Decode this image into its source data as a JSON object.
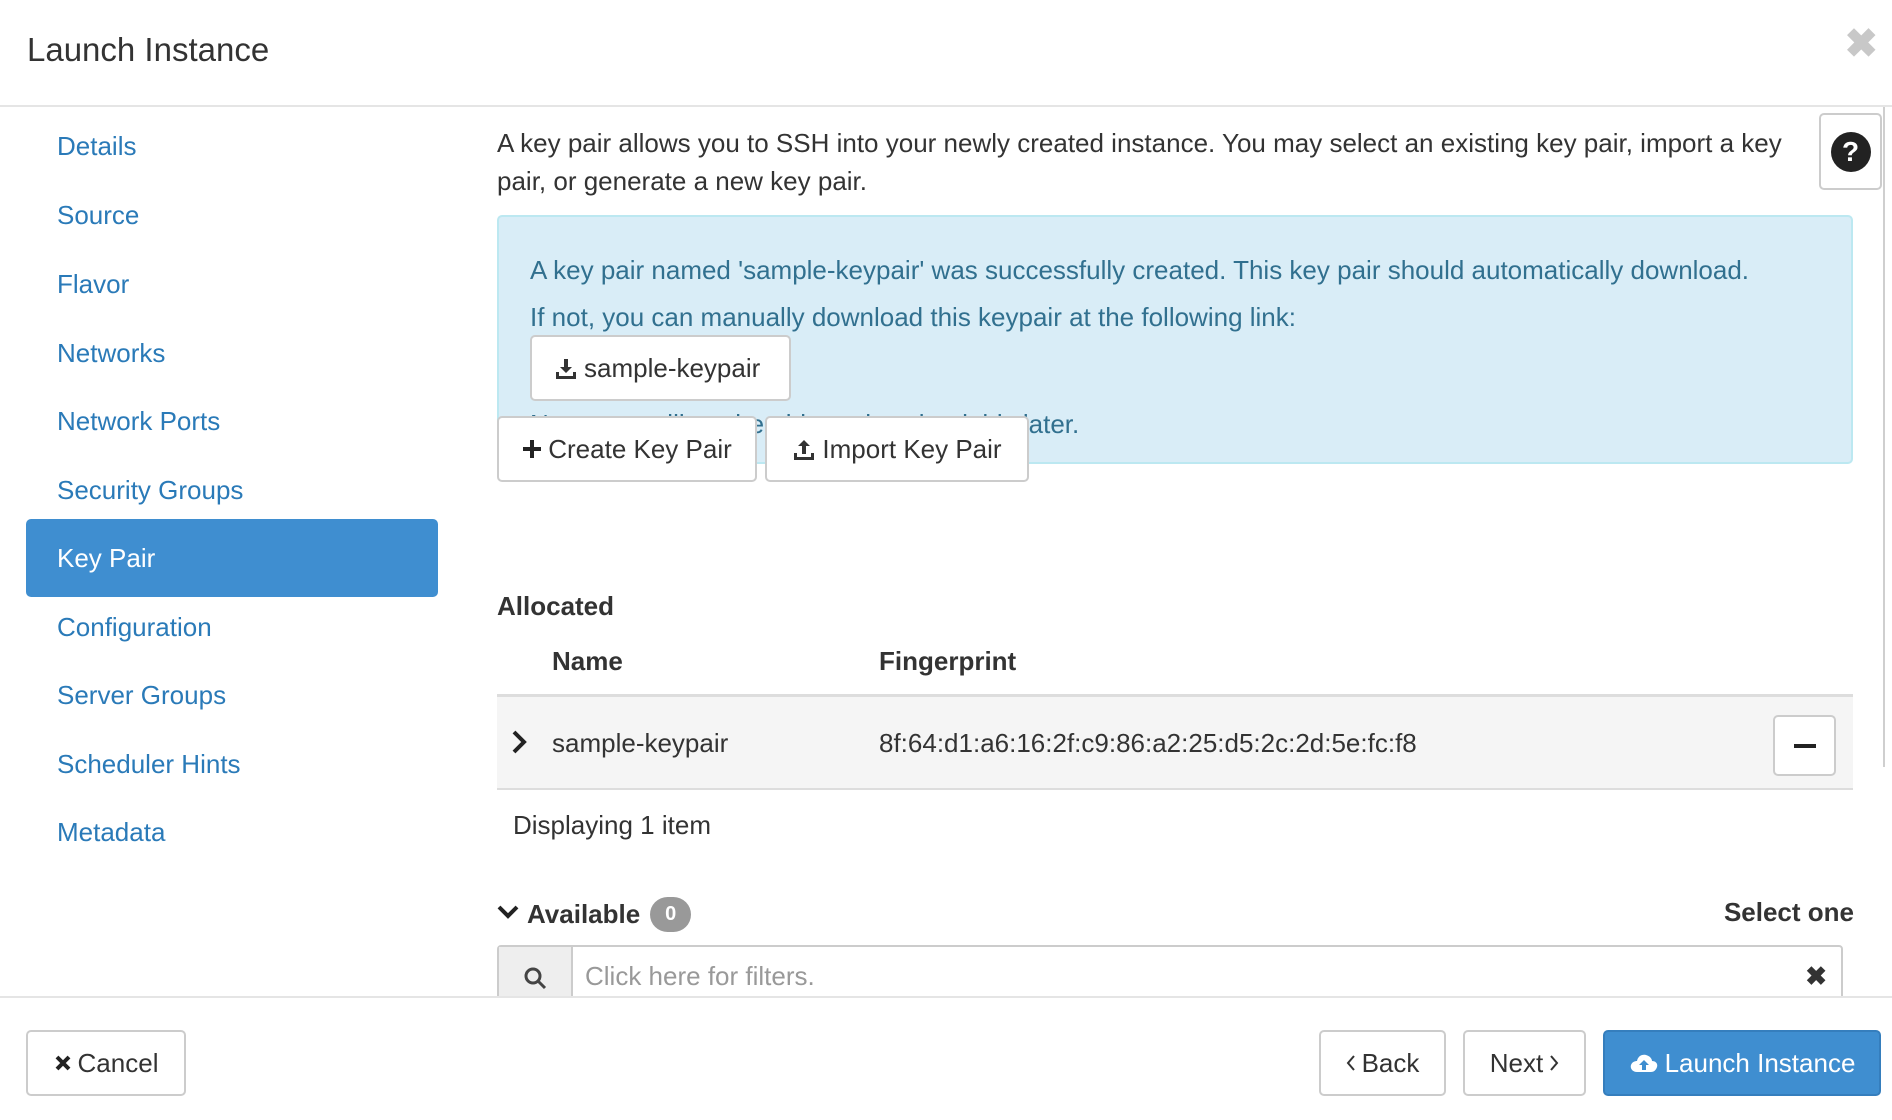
{
  "modal": {
    "title": "Launch Instance",
    "close_glyph": "✖"
  },
  "sidebar": {
    "items": [
      {
        "label": "Details",
        "active": false
      },
      {
        "label": "Source",
        "active": false
      },
      {
        "label": "Flavor",
        "active": false
      },
      {
        "label": "Networks",
        "active": false
      },
      {
        "label": "Network Ports",
        "active": false
      },
      {
        "label": "Security Groups",
        "active": false
      },
      {
        "label": "Key Pair",
        "active": true
      },
      {
        "label": "Configuration",
        "active": false
      },
      {
        "label": "Server Groups",
        "active": false
      },
      {
        "label": "Scheduler Hints",
        "active": false
      },
      {
        "label": "Metadata",
        "active": false
      }
    ]
  },
  "main": {
    "intro": "A key pair allows you to SSH into your newly created instance. You may select an existing key pair, import a key pair, or generate a new key pair.",
    "help_glyph": "?",
    "alert": {
      "line1": "A key pair named 'sample-keypair' was successfully created. This key pair should automatically download.",
      "line2": "If not, you can manually download this keypair at the following link:",
      "download_label": "sample-keypair",
      "note": "Note: you will not be able to download this later."
    },
    "create_key_pair_label": "Create Key Pair",
    "import_key_pair_label": "Import Key Pair",
    "allocated": {
      "heading": "Allocated",
      "columns": [
        "Name",
        "Fingerprint"
      ],
      "rows": [
        {
          "name": "sample-keypair",
          "fingerprint": "8f:64:d1:a6:16:2f:c9:86:a2:25:d5:2c:2d:5e:fc:f8"
        }
      ],
      "displaying": "Displaying 1 item"
    },
    "available": {
      "heading": "Available",
      "count": "0",
      "select_hint": "Select one",
      "filter_placeholder": "Click here for filters.",
      "filter_clear_glyph": "✖"
    }
  },
  "footer": {
    "cancel_label": "Cancel",
    "back_label": "Back",
    "next_label": "Next",
    "launch_label": "Launch Instance"
  },
  "icons": {
    "download": "download-icon",
    "plus": "plus-icon",
    "upload": "upload-icon",
    "search": "search-icon",
    "chevron": "chevron-right-icon",
    "cloud_upload": "cloud-upload-icon"
  },
  "colors": {
    "accent": "#3f8ed0",
    "link": "#2a7ab8",
    "alert_bg": "#d9edf7",
    "alert_text": "#31708f",
    "badge": "#999999"
  }
}
